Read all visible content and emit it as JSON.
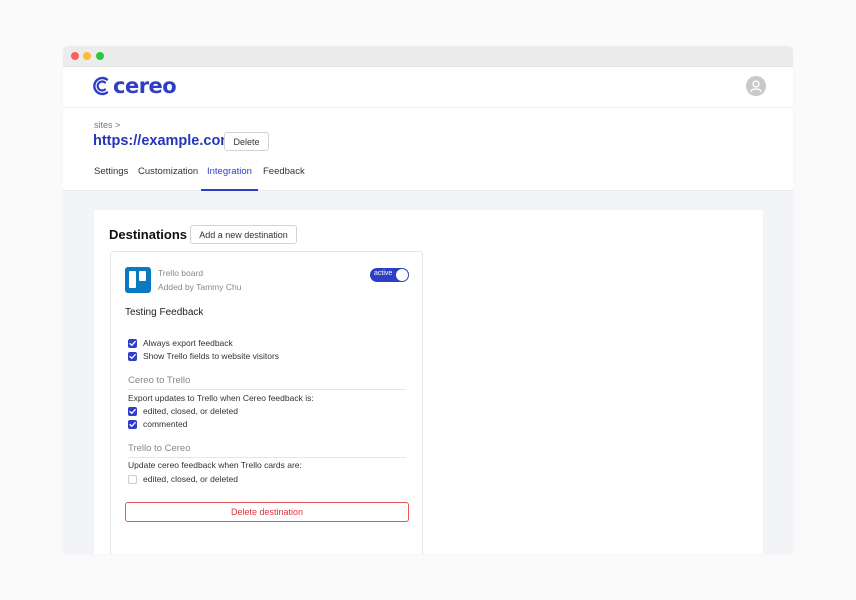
{
  "brand": {
    "logo_text": "cereo",
    "color": "#2e3fc6"
  },
  "header": {
    "breadcrumb": "sites >",
    "site_title": "https://example.com",
    "delete_label": "Delete"
  },
  "tabs": [
    {
      "label": "Settings"
    },
    {
      "label": "Customization"
    },
    {
      "label": "Integration",
      "active": true
    },
    {
      "label": "Feedback"
    }
  ],
  "destinations": {
    "title": "Destinations",
    "add_label": "Add a new destination",
    "card": {
      "service_icon": "trello-icon",
      "service_name": "Trello board",
      "added_by": "Added by Tammy Chu",
      "toggle_label": "active",
      "title": "Testing Feedback",
      "options": [
        {
          "label": "Always export feedback",
          "checked": true
        },
        {
          "label": "Show Trello fields to website visitors",
          "checked": true
        }
      ],
      "cereo_to_trello": {
        "heading": "Cereo to Trello",
        "description": "Export updates to Trello when Cereo feedback is:",
        "items": [
          {
            "label": "edited, closed, or deleted",
            "checked": true
          },
          {
            "label": "commented",
            "checked": true
          }
        ]
      },
      "trello_to_cereo": {
        "heading": "Trello to Cereo",
        "description": "Update cereo feedback when Trello cards are:",
        "items": [
          {
            "label": "edited, closed, or deleted",
            "checked": false
          }
        ]
      },
      "delete_label": "Delete destination"
    }
  }
}
